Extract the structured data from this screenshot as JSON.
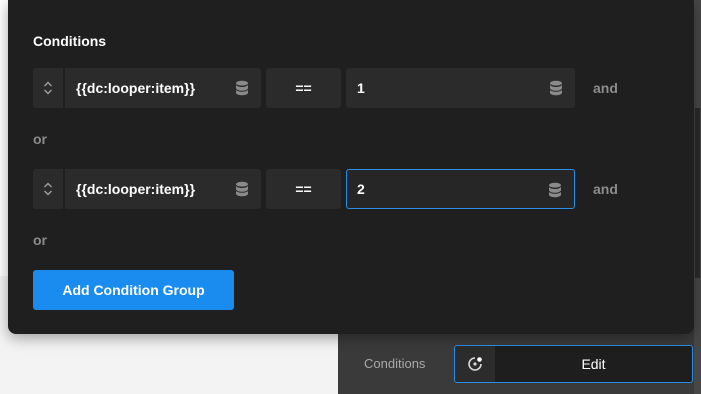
{
  "panel": {
    "title": "Conditions",
    "rows": [
      {
        "left_value": "{{dc:looper:item}}",
        "operator": "==",
        "right_value": "1",
        "connector": "and"
      },
      {
        "left_value": "{{dc:looper:item}}",
        "operator": "==",
        "right_value": "2",
        "connector": "and"
      }
    ],
    "or_labels": [
      "or",
      "or"
    ],
    "add_group_label": "Add Condition Group"
  },
  "bottom": {
    "label": "Conditions",
    "edit_label": "Edit"
  },
  "colors": {
    "accent": "#1a8cf0",
    "panel_bg": "#1f1f1f",
    "field_bg": "#2b2b2b",
    "focus_border": "#2a8de6"
  }
}
